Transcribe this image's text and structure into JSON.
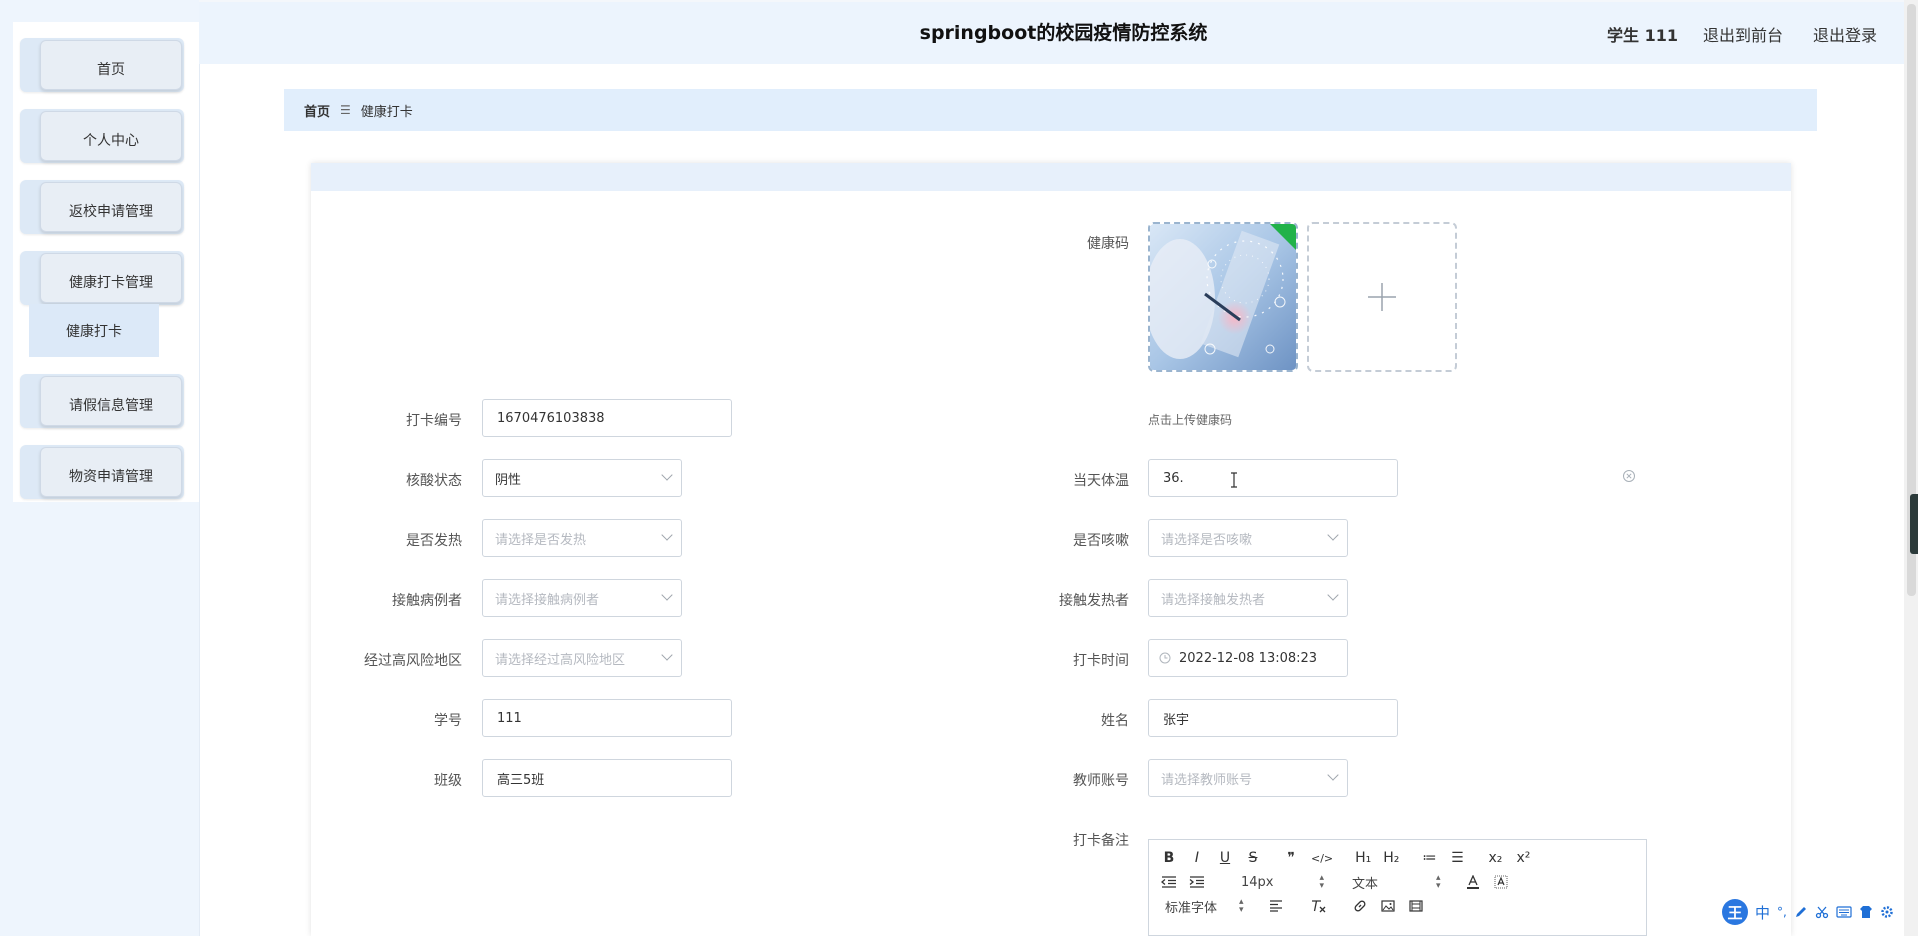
{
  "header": {
    "title": "springboot的校园疫情防控系统",
    "user_label": "学生 111",
    "front_link": "退出到前台",
    "logout_link": "退出登录"
  },
  "sidebar": {
    "items": [
      {
        "label": "首页"
      },
      {
        "label": "个人中心"
      },
      {
        "label": "返校申请管理"
      },
      {
        "label": "健康打卡管理"
      },
      {
        "label": "请假信息管理"
      },
      {
        "label": "物资申请管理"
      }
    ],
    "submenu_label": "健康打卡"
  },
  "breadcrumb": {
    "home": "首页",
    "separator": "☰",
    "current": "健康打卡"
  },
  "form": {
    "health_code_label": "健康码",
    "health_code_hint": "点击上传健康码",
    "checkin_no_label": "打卡编号",
    "checkin_no_value": "1670476103838",
    "nucleic_label": "核酸状态",
    "nucleic_value": "阴性",
    "temp_label": "当天体温",
    "temp_value": "36.",
    "fever_label": "是否发热",
    "fever_placeholder": "请选择是否发热",
    "cough_label": "是否咳嗽",
    "cough_placeholder": "请选择是否咳嗽",
    "contact_case_label": "接触病例者",
    "contact_case_placeholder": "请选择接触病例者",
    "contact_fever_label": "接触发热者",
    "contact_fever_placeholder": "请选择接触发热者",
    "risk_area_label": "经过高风险地区",
    "risk_area_placeholder": "请选择经过高风险地区",
    "checkin_time_label": "打卡时间",
    "checkin_time_value": "2022-12-08 13:08:23",
    "student_no_label": "学号",
    "student_no_value": "111",
    "name_label": "姓名",
    "name_value": "张宇",
    "class_label": "班级",
    "class_value": "高三5班",
    "teacher_label": "教师账号",
    "teacher_placeholder": "请选择教师账号",
    "remark_label": "打卡备注"
  },
  "editor": {
    "row1": [
      "B",
      "I",
      "U",
      "S",
      "❞",
      "</>",
      "H₁",
      "H₂",
      "≔",
      "☰",
      "x₂",
      "x²"
    ],
    "font_size": "14px",
    "text_type": "文本",
    "font_family": "标准字体"
  },
  "ime": {
    "logo": "王",
    "mode": "中",
    "punct": "°,"
  },
  "colors": {
    "sidebar_bg": "#eef5fd",
    "header_bg": "#ecf4fd",
    "breadcrumb_bg": "#e1eefc",
    "accent_green": "#21b24a"
  }
}
